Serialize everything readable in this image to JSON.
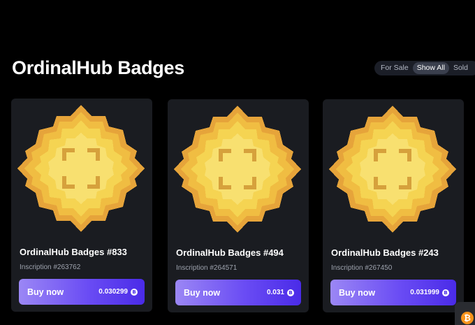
{
  "page": {
    "title": "OrdinalHub Badges"
  },
  "filters": [
    {
      "label": "For Sale",
      "active": false
    },
    {
      "label": "Show All",
      "active": true
    },
    {
      "label": "Sold",
      "active": false
    }
  ],
  "cards": [
    {
      "name": "OrdinalHub Badges #833",
      "inscription": "Inscription #263762",
      "buy_label": "Buy now",
      "price": "0.030299",
      "price_icon": "bitcoin-icon"
    },
    {
      "name": "OrdinalHub Badges #494",
      "inscription": "Inscription #264571",
      "buy_label": "Buy now",
      "price": "0.031",
      "price_icon": "bitcoin-icon"
    },
    {
      "name": "OrdinalHub Badges #243",
      "inscription": "Inscription #267450",
      "buy_label": "Buy now",
      "price": "0.031999",
      "price_icon": "bitcoin-icon"
    }
  ],
  "colors": {
    "background": "#000000",
    "card": "#1a1c21",
    "badge_outer": "#e8a93b",
    "badge_mid": "#f2c345",
    "badge_inner": "#f7dc5e",
    "badge_mark": "#d9a23c",
    "button_start": "#9b87f5",
    "button_end": "#4a2be8",
    "bitcoin": "#f7931a"
  },
  "corner_widget": {
    "icon": "bitcoin-icon",
    "glyph": "₿"
  },
  "btc_glyph": "B"
}
